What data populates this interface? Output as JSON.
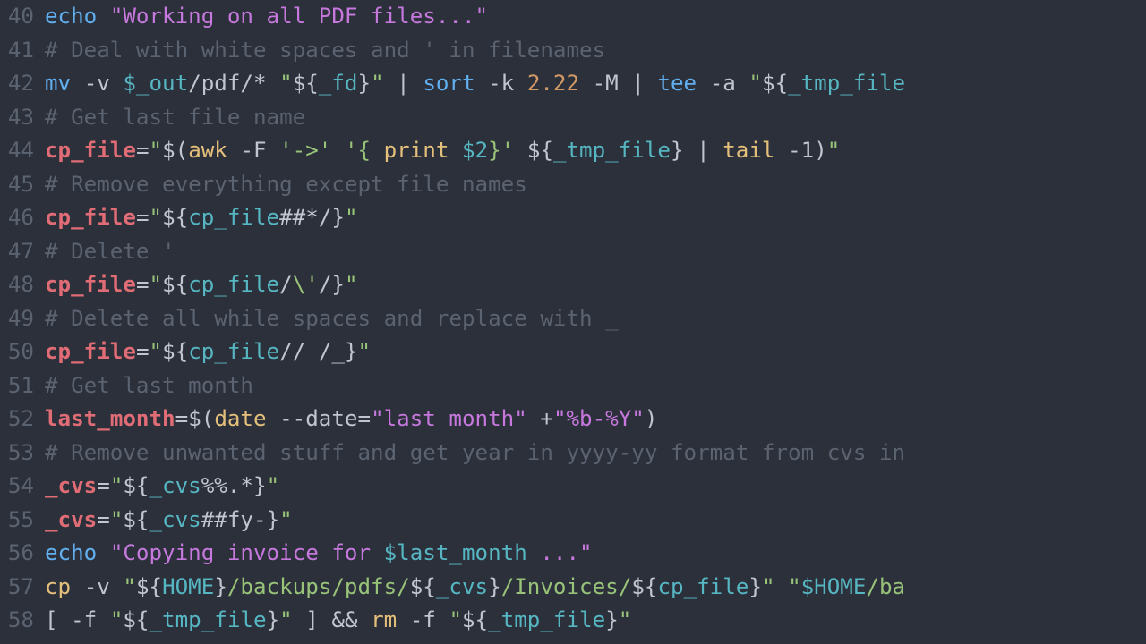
{
  "editor": {
    "lines": [
      {
        "num": "40",
        "tokens": [
          {
            "t": "echo ",
            "c": "tok-blue"
          },
          {
            "t": "\"Working on all PDF files...\"",
            "c": "tok-purple"
          }
        ]
      },
      {
        "num": "41",
        "tokens": [
          {
            "t": "# Deal with white spaces and ' in filenames",
            "c": "tok-grey"
          }
        ]
      },
      {
        "num": "42",
        "tokens": [
          {
            "t": "mv ",
            "c": "tok-blue"
          },
          {
            "t": "-v ",
            "c": "tok-white"
          },
          {
            "t": "$_out",
            "c": "tok-cyan"
          },
          {
            "t": "/pdf/* ",
            "c": "tok-white"
          },
          {
            "t": "\"",
            "c": "tok-green"
          },
          {
            "t": "${",
            "c": "tok-white"
          },
          {
            "t": "_fd",
            "c": "tok-cyan"
          },
          {
            "t": "}",
            "c": "tok-white"
          },
          {
            "t": "\"",
            "c": "tok-green"
          },
          {
            "t": " | ",
            "c": "tok-white"
          },
          {
            "t": "sort ",
            "c": "tok-blue"
          },
          {
            "t": "-k ",
            "c": "tok-white"
          },
          {
            "t": "2.22",
            "c": "tok-orange"
          },
          {
            "t": " -M ",
            "c": "tok-white"
          },
          {
            "t": "| ",
            "c": "tok-white"
          },
          {
            "t": "tee ",
            "c": "tok-blue"
          },
          {
            "t": "-a ",
            "c": "tok-white"
          },
          {
            "t": "\"",
            "c": "tok-green"
          },
          {
            "t": "${",
            "c": "tok-white"
          },
          {
            "t": "_tmp_file",
            "c": "tok-cyan"
          }
        ]
      },
      {
        "num": "43",
        "tokens": [
          {
            "t": "# Get last file name",
            "c": "tok-grey"
          }
        ]
      },
      {
        "num": "44",
        "tokens": [
          {
            "t": "cp_file",
            "c": "tok-red bold"
          },
          {
            "t": "=",
            "c": "tok-white"
          },
          {
            "t": "\"",
            "c": "tok-green"
          },
          {
            "t": "$(",
            "c": "tok-white"
          },
          {
            "t": "awk ",
            "c": "tok-yellow"
          },
          {
            "t": "-F ",
            "c": "tok-white"
          },
          {
            "t": "'->'",
            "c": "tok-green"
          },
          {
            "t": " ",
            "c": "tok-white"
          },
          {
            "t": "'{ ",
            "c": "tok-green"
          },
          {
            "t": "print ",
            "c": "tok-yellow"
          },
          {
            "t": "$2",
            "c": "tok-cyan"
          },
          {
            "t": "}'",
            "c": "tok-green"
          },
          {
            "t": " ",
            "c": "tok-white"
          },
          {
            "t": "${",
            "c": "tok-white"
          },
          {
            "t": "_tmp_file",
            "c": "tok-cyan"
          },
          {
            "t": "}",
            "c": "tok-white"
          },
          {
            "t": " | ",
            "c": "tok-white"
          },
          {
            "t": "tail ",
            "c": "tok-yellow"
          },
          {
            "t": "-1",
            "c": "tok-white"
          },
          {
            "t": ")",
            "c": "tok-white"
          },
          {
            "t": "\"",
            "c": "tok-green"
          }
        ]
      },
      {
        "num": "45",
        "tokens": [
          {
            "t": "# Remove everything except file names",
            "c": "tok-grey"
          }
        ]
      },
      {
        "num": "46",
        "tokens": [
          {
            "t": "cp_file",
            "c": "tok-red bold"
          },
          {
            "t": "=",
            "c": "tok-white"
          },
          {
            "t": "\"",
            "c": "tok-green"
          },
          {
            "t": "${",
            "c": "tok-white"
          },
          {
            "t": "cp_file",
            "c": "tok-cyan"
          },
          {
            "t": "##*/",
            "c": "tok-white"
          },
          {
            "t": "}",
            "c": "tok-white"
          },
          {
            "t": "\"",
            "c": "tok-green"
          }
        ]
      },
      {
        "num": "47",
        "tokens": [
          {
            "t": "# Delete '",
            "c": "tok-grey"
          }
        ]
      },
      {
        "num": "48",
        "tokens": [
          {
            "t": "cp_file",
            "c": "tok-red bold"
          },
          {
            "t": "=",
            "c": "tok-white"
          },
          {
            "t": "\"",
            "c": "tok-green"
          },
          {
            "t": "${",
            "c": "tok-white"
          },
          {
            "t": "cp_file",
            "c": "tok-cyan"
          },
          {
            "t": "/",
            "c": "tok-white"
          },
          {
            "t": "\\'",
            "c": "tok-green"
          },
          {
            "t": "/",
            "c": "tok-white"
          },
          {
            "t": "}",
            "c": "tok-white"
          },
          {
            "t": "\"",
            "c": "tok-green"
          }
        ]
      },
      {
        "num": "49",
        "tokens": [
          {
            "t": "# Delete all while spaces and replace with _",
            "c": "tok-grey"
          }
        ]
      },
      {
        "num": "50",
        "tokens": [
          {
            "t": "cp_file",
            "c": "tok-red bold"
          },
          {
            "t": "=",
            "c": "tok-white"
          },
          {
            "t": "\"",
            "c": "tok-green"
          },
          {
            "t": "${",
            "c": "tok-white"
          },
          {
            "t": "cp_file",
            "c": "tok-cyan"
          },
          {
            "t": "// /_",
            "c": "tok-white"
          },
          {
            "t": "}",
            "c": "tok-white"
          },
          {
            "t": "\"",
            "c": "tok-green"
          }
        ]
      },
      {
        "num": "51",
        "tokens": [
          {
            "t": "# Get last month",
            "c": "tok-grey"
          }
        ]
      },
      {
        "num": "52",
        "tokens": [
          {
            "t": "last_month",
            "c": "tok-red bold"
          },
          {
            "t": "=",
            "c": "tok-white"
          },
          {
            "t": "$(",
            "c": "tok-white"
          },
          {
            "t": "date ",
            "c": "tok-yellow"
          },
          {
            "t": "--date=",
            "c": "tok-white"
          },
          {
            "t": "\"last month\"",
            "c": "tok-purple"
          },
          {
            "t": " +",
            "c": "tok-white"
          },
          {
            "t": "\"%b-%Y\"",
            "c": "tok-purple"
          },
          {
            "t": ")",
            "c": "tok-white"
          }
        ]
      },
      {
        "num": "53",
        "tokens": [
          {
            "t": "# Remove unwanted stuff and get year in yyyy-yy format from cvs in",
            "c": "tok-grey"
          }
        ]
      },
      {
        "num": "54",
        "tokens": [
          {
            "t": "_cvs",
            "c": "tok-red bold"
          },
          {
            "t": "=",
            "c": "tok-white"
          },
          {
            "t": "\"",
            "c": "tok-green"
          },
          {
            "t": "${",
            "c": "tok-white"
          },
          {
            "t": "_cvs",
            "c": "tok-cyan"
          },
          {
            "t": "%%.*",
            "c": "tok-white"
          },
          {
            "t": "}",
            "c": "tok-white"
          },
          {
            "t": "\"",
            "c": "tok-green"
          }
        ]
      },
      {
        "num": "55",
        "tokens": [
          {
            "t": "_cvs",
            "c": "tok-red bold"
          },
          {
            "t": "=",
            "c": "tok-white"
          },
          {
            "t": "\"",
            "c": "tok-green"
          },
          {
            "t": "${",
            "c": "tok-white"
          },
          {
            "t": "_cvs",
            "c": "tok-cyan"
          },
          {
            "t": "##fy-",
            "c": "tok-white"
          },
          {
            "t": "}",
            "c": "tok-white"
          },
          {
            "t": "\"",
            "c": "tok-green"
          }
        ]
      },
      {
        "num": "56",
        "tokens": [
          {
            "t": "echo ",
            "c": "tok-blue"
          },
          {
            "t": "\"Copying invoice for ",
            "c": "tok-purple"
          },
          {
            "t": "$last_month",
            "c": "tok-cyan"
          },
          {
            "t": " ...\"",
            "c": "tok-purple"
          }
        ]
      },
      {
        "num": "57",
        "tokens": [
          {
            "t": "cp ",
            "c": "tok-yellow"
          },
          {
            "t": "-v ",
            "c": "tok-white"
          },
          {
            "t": "\"",
            "c": "tok-green"
          },
          {
            "t": "${",
            "c": "tok-white"
          },
          {
            "t": "HOME",
            "c": "tok-cyan"
          },
          {
            "t": "}",
            "c": "tok-white"
          },
          {
            "t": "/backups/pdfs/",
            "c": "tok-green"
          },
          {
            "t": "${",
            "c": "tok-white"
          },
          {
            "t": "_cvs",
            "c": "tok-cyan"
          },
          {
            "t": "}",
            "c": "tok-white"
          },
          {
            "t": "/Invoices/",
            "c": "tok-green"
          },
          {
            "t": "${",
            "c": "tok-white"
          },
          {
            "t": "cp_file",
            "c": "tok-cyan"
          },
          {
            "t": "}",
            "c": "tok-white"
          },
          {
            "t": "\"",
            "c": "tok-green"
          },
          {
            "t": " ",
            "c": "tok-white"
          },
          {
            "t": "\"",
            "c": "tok-green"
          },
          {
            "t": "$HOME",
            "c": "tok-cyan"
          },
          {
            "t": "/ba",
            "c": "tok-green"
          }
        ]
      },
      {
        "num": "58",
        "tokens": [
          {
            "t": "[ -f ",
            "c": "tok-white"
          },
          {
            "t": "\"",
            "c": "tok-green"
          },
          {
            "t": "${",
            "c": "tok-white"
          },
          {
            "t": "_tmp_file",
            "c": "tok-cyan"
          },
          {
            "t": "}",
            "c": "tok-white"
          },
          {
            "t": "\"",
            "c": "tok-green"
          },
          {
            "t": " ] ",
            "c": "tok-white"
          },
          {
            "t": "&&",
            "c": "tok-white"
          },
          {
            "t": " ",
            "c": "tok-white"
          },
          {
            "t": "rm ",
            "c": "tok-yellow"
          },
          {
            "t": "-f ",
            "c": "tok-white"
          },
          {
            "t": "\"",
            "c": "tok-green"
          },
          {
            "t": "${",
            "c": "tok-white"
          },
          {
            "t": "_tmp_file",
            "c": "tok-cyan"
          },
          {
            "t": "}",
            "c": "tok-white"
          },
          {
            "t": "\"",
            "c": "tok-green"
          }
        ]
      }
    ]
  }
}
